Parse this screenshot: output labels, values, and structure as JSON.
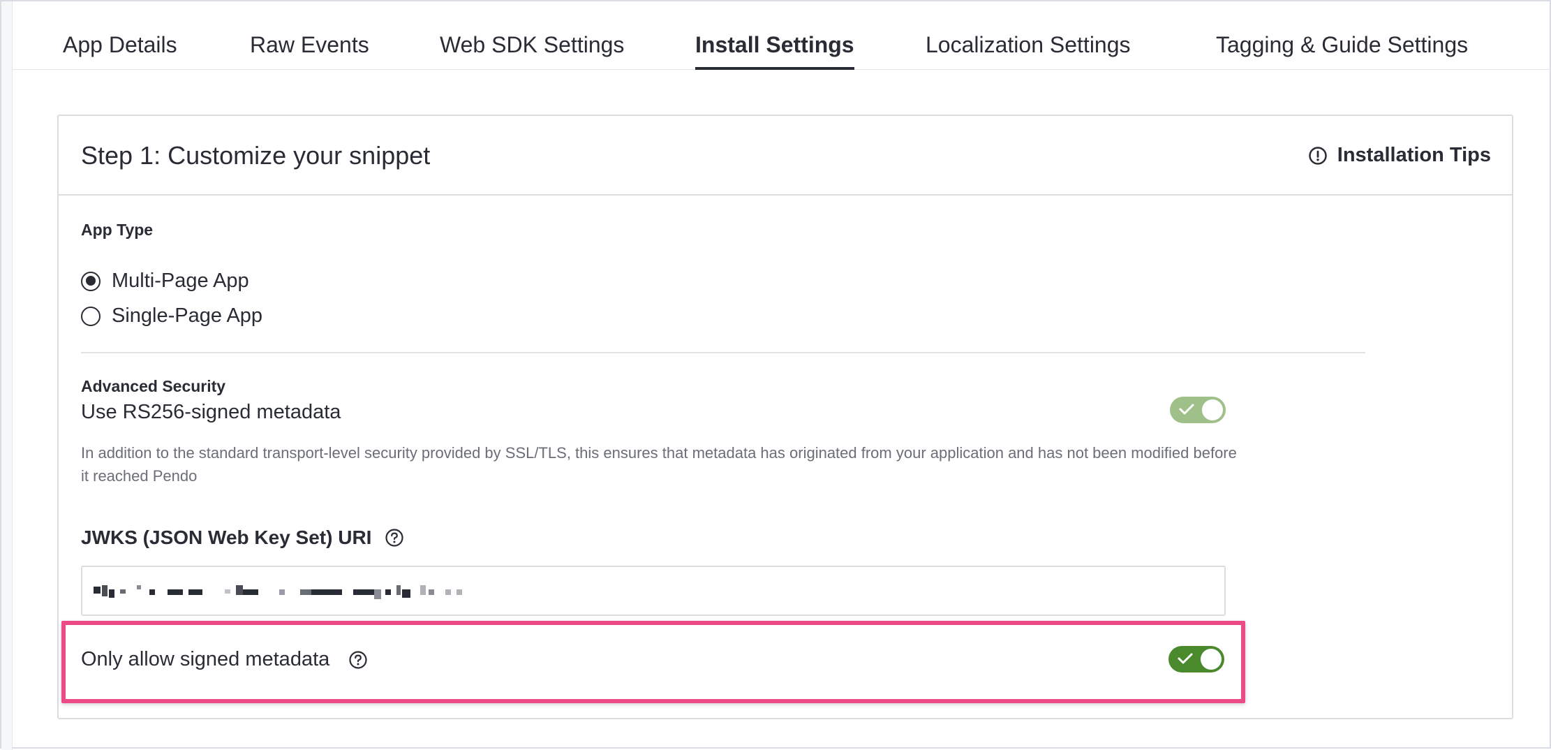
{
  "tabs": [
    {
      "label": "App Details",
      "active": false
    },
    {
      "label": "Raw Events",
      "active": false
    },
    {
      "label": "Web SDK Settings",
      "active": false
    },
    {
      "label": "Install Settings",
      "active": true
    },
    {
      "label": "Localization Settings",
      "active": false
    },
    {
      "label": "Tagging & Guide Settings",
      "active": false
    }
  ],
  "card": {
    "title": "Step 1: Customize your snippet",
    "tips_label": "Installation Tips",
    "tips_icon": "alert-circle-icon"
  },
  "app_type": {
    "label": "App Type",
    "options": [
      {
        "label": "Multi-Page App",
        "checked": true
      },
      {
        "label": "Single-Page App",
        "checked": false
      }
    ]
  },
  "security": {
    "label": "Advanced Security",
    "setting_label": "Use RS256-signed metadata",
    "toggle_on": true,
    "description": "In addition to the standard transport-level security provided by SSL/TLS, this ensures that metadata has originated from your application and has not been modified before it reached Pendo"
  },
  "jwks": {
    "label": "JWKS (JSON Web Key Set) URI",
    "help_icon": "help-circle-icon",
    "value": ""
  },
  "signed_only": {
    "label": "Only allow signed metadata",
    "help_icon": "help-circle-icon",
    "toggle_on": true
  },
  "colors": {
    "highlight": "#ec4b86",
    "toggle_on": "#4b8a2c",
    "toggle_muted": "#a0c08a",
    "text": "#2a2c35"
  }
}
